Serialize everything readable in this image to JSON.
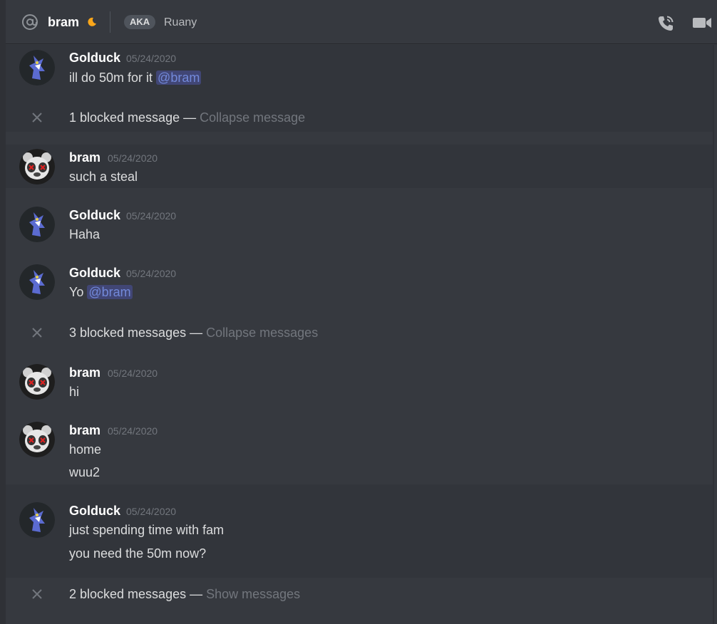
{
  "header": {
    "username": "bram",
    "aka_label": "AKA",
    "nickname": "Ruany"
  },
  "icons": {
    "mention": "at-icon",
    "status": "moon-icon",
    "call": "phone-call-icon",
    "video": "video-camera-icon",
    "close": "close-icon"
  },
  "colors": {
    "background": "#36393f",
    "mention_text": "#7289da",
    "timestamp": "#72767d"
  },
  "messages": [
    {
      "author": "Golduck",
      "timestamp": "05/24/2020",
      "line1_text": "ill do 50m for it ",
      "line1_mention": "@bram"
    },
    {
      "blocked_count": "1 blocked message",
      "separator": " — ",
      "action": "Collapse message"
    },
    {
      "author": "bram",
      "timestamp": "05/24/2020",
      "line1": "such a steal"
    },
    {
      "author": "Golduck",
      "timestamp": "05/24/2020",
      "line1": "Haha"
    },
    {
      "author": "Golduck",
      "timestamp": "05/24/2020",
      "line1_text": "Yo ",
      "line1_mention": "@bram"
    },
    {
      "blocked_count": "3 blocked messages",
      "separator": " — ",
      "action": "Collapse messages"
    },
    {
      "author": "bram",
      "timestamp": "05/24/2020",
      "line1": "hi"
    },
    {
      "author": "bram",
      "timestamp": "05/24/2020",
      "line1": "home",
      "line2": "wuu2"
    },
    {
      "author": "Golduck",
      "timestamp": "05/24/2020",
      "line1": "just spending time with fam",
      "line2": "you need the 50m now?"
    },
    {
      "blocked_count": "2 blocked messages",
      "separator": " — ",
      "action": "Show messages"
    }
  ]
}
